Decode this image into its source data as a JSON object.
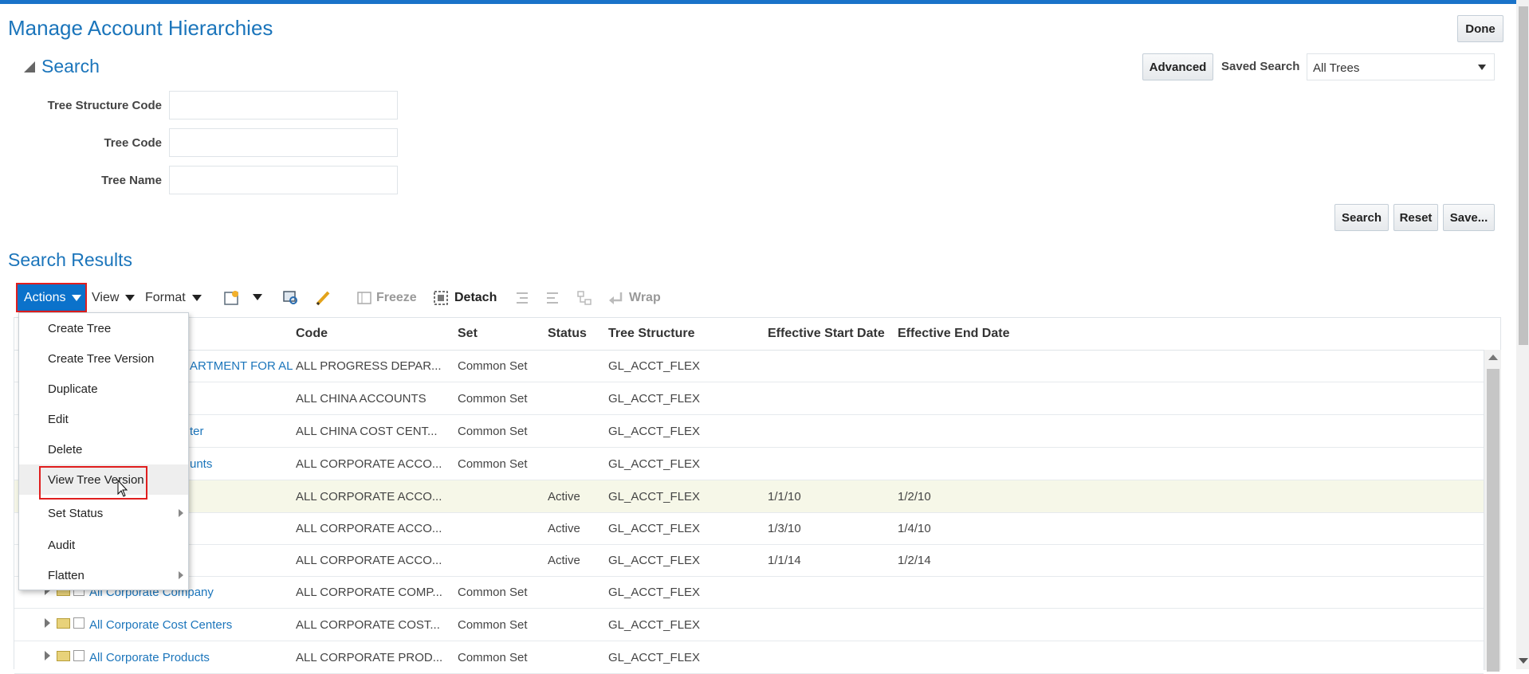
{
  "page": {
    "title": "Manage Account Hierarchies",
    "done_label": "Done"
  },
  "search": {
    "heading": "Search",
    "advanced_label": "Advanced",
    "saved_search_label": "Saved Search",
    "saved_search_value": "All Trees",
    "fields": [
      {
        "label": "Tree Structure Code",
        "value": ""
      },
      {
        "label": "Tree Code",
        "value": ""
      },
      {
        "label": "Tree Name",
        "value": ""
      }
    ],
    "search_button": "Search",
    "reset_button": "Reset",
    "save_button": "Save..."
  },
  "results": {
    "heading": "Search Results",
    "toolbar": {
      "actions": "Actions",
      "view": "View",
      "format": "Format",
      "freeze": "Freeze",
      "detach": "Detach",
      "wrap": "Wrap"
    },
    "columns": [
      "Code",
      "Set",
      "Status",
      "Tree Structure",
      "Effective Start Date",
      "Effective End Date"
    ],
    "rows": [
      {
        "name": "ARTMENT FOR AL",
        "code": "ALL PROGRESS DEPAR...",
        "set": "Common Set",
        "status": "",
        "structure": "GL_ACCT_FLEX",
        "start": "",
        "end": ""
      },
      {
        "name": "",
        "code": "ALL CHINA ACCOUNTS",
        "set": "Common Set",
        "status": "",
        "structure": "GL_ACCT_FLEX",
        "start": "",
        "end": ""
      },
      {
        "name": "ter",
        "code": "ALL CHINA COST CENT...",
        "set": "Common Set",
        "status": "",
        "structure": "GL_ACCT_FLEX",
        "start": "",
        "end": ""
      },
      {
        "name": "unts",
        "code": "ALL CORPORATE ACCO...",
        "set": "Common Set",
        "status": "",
        "structure": "GL_ACCT_FLEX",
        "start": "",
        "end": ""
      },
      {
        "name": "",
        "code": "ALL CORPORATE ACCO...",
        "set": "",
        "status": "Active",
        "structure": "GL_ACCT_FLEX",
        "start": "1/1/10",
        "end": "1/2/10"
      },
      {
        "name": "",
        "code": "ALL CORPORATE ACCO...",
        "set": "",
        "status": "Active",
        "structure": "GL_ACCT_FLEX",
        "start": "1/3/10",
        "end": "1/4/10"
      },
      {
        "name": "",
        "code": "ALL CORPORATE ACCO...",
        "set": "",
        "status": "Active",
        "structure": "GL_ACCT_FLEX",
        "start": "1/1/14",
        "end": "1/2/14"
      },
      {
        "name": "All Corporate Company",
        "code": "ALL CORPORATE COMP...",
        "set": "Common Set",
        "status": "",
        "structure": "GL_ACCT_FLEX",
        "start": "",
        "end": ""
      },
      {
        "name": "All Corporate Cost Centers",
        "code": "ALL CORPORATE COST...",
        "set": "Common Set",
        "status": "",
        "structure": "GL_ACCT_FLEX",
        "start": "",
        "end": ""
      },
      {
        "name": "All Corporate Products",
        "code": "ALL CORPORATE PROD...",
        "set": "Common Set",
        "status": "",
        "structure": "GL_ACCT_FLEX",
        "start": "",
        "end": ""
      }
    ]
  },
  "actions_menu": {
    "items": [
      {
        "label": "Create Tree"
      },
      {
        "label": "Create Tree Version"
      },
      {
        "label": "Duplicate"
      },
      {
        "label": "Edit"
      },
      {
        "label": "Delete"
      },
      {
        "label": "View Tree Version"
      },
      {
        "label": "Set Status"
      },
      {
        "label": "Audit"
      },
      {
        "label": "Flatten"
      }
    ]
  },
  "colors": {
    "accent": "#1b75bb",
    "actions_bg": "#0b72cb",
    "highlight_border": "#e01e1e",
    "selected_row": "#f6f7e8"
  }
}
